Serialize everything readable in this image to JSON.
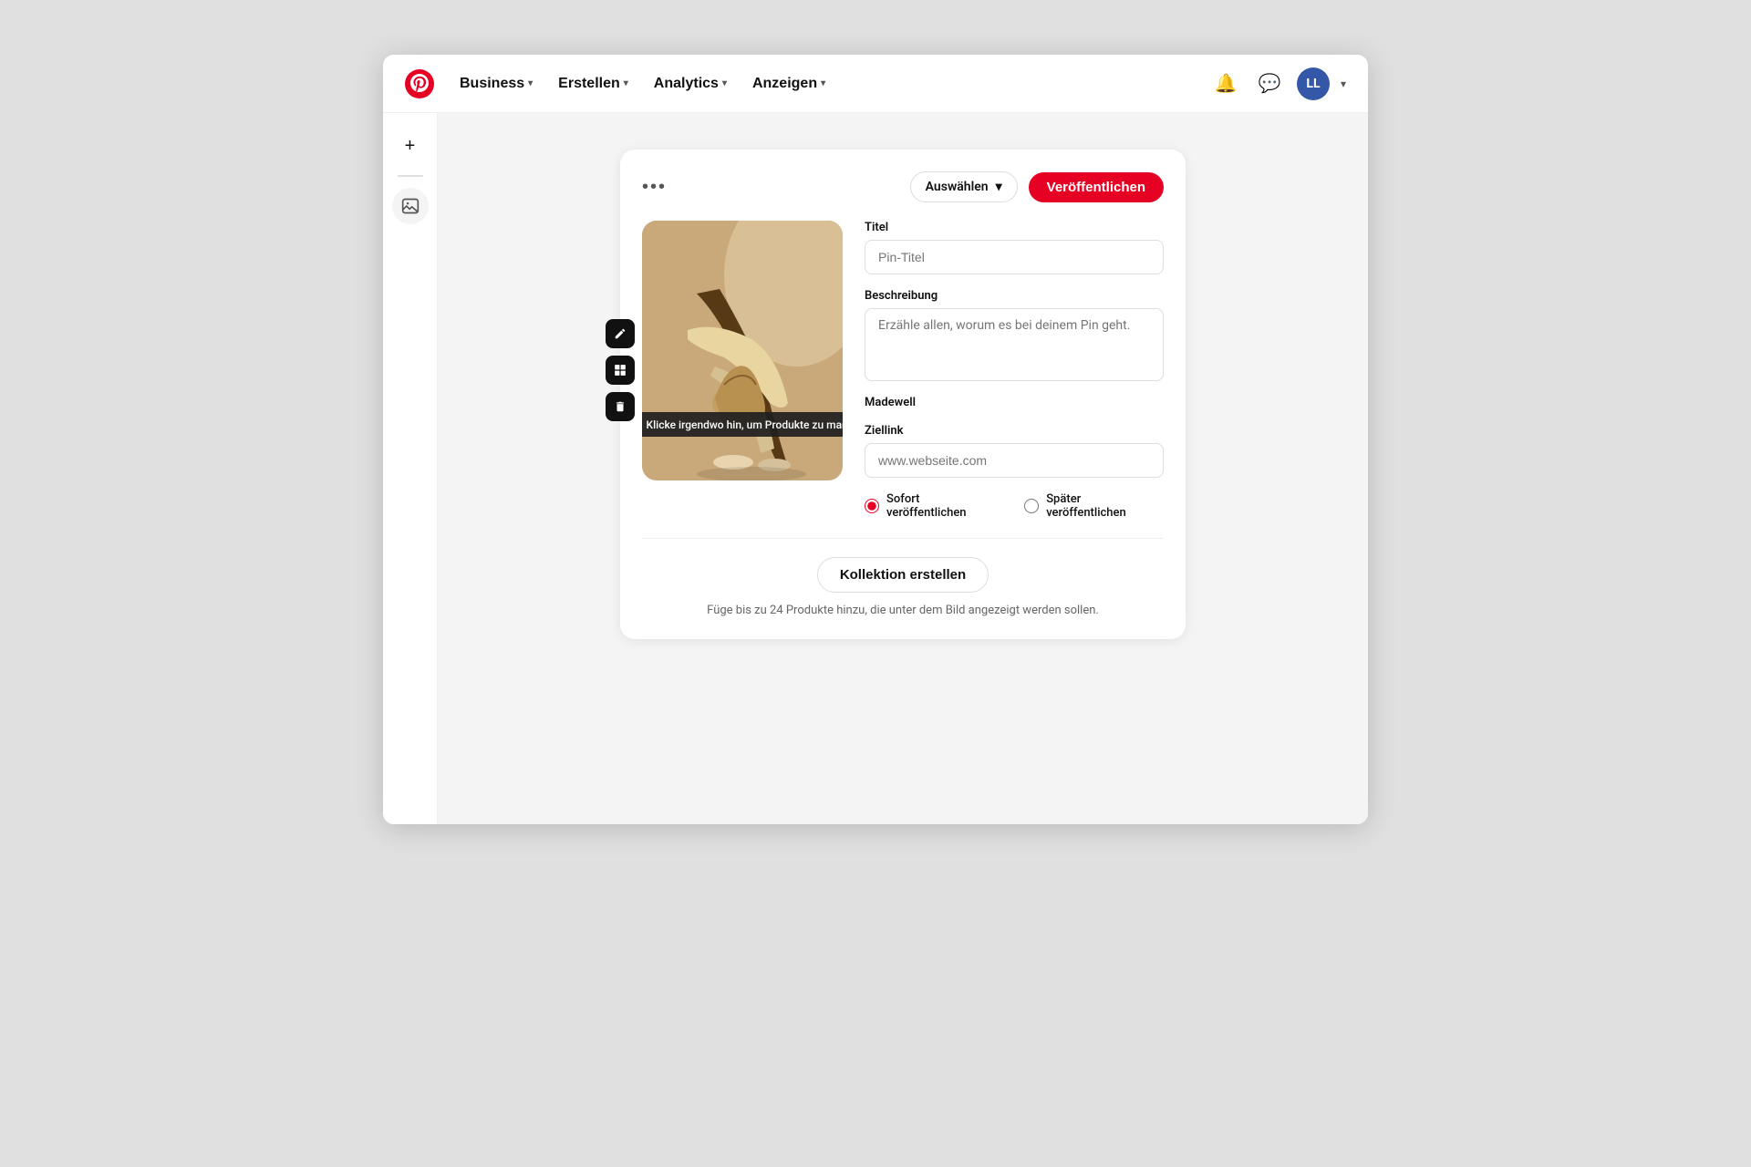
{
  "nav": {
    "business_label": "Business",
    "erstellen_label": "Erstellen",
    "analytics_label": "Analytics",
    "anzeigen_label": "Anzeigen",
    "user_initials": "LL"
  },
  "sidebar": {
    "add_label": "+",
    "image_label": "🖼"
  },
  "card": {
    "dots_label": "•••",
    "select_placeholder": "Auswählen",
    "publish_label": "Veröffentlichen",
    "title_label": "Titel",
    "title_placeholder": "Pin-Titel",
    "description_label": "Beschreibung",
    "description_placeholder": "Erzähle allen, worum es bei deinem Pin geht.",
    "brand_name": "Madewell",
    "link_label": "Ziellink",
    "link_placeholder": "www.webseite.com",
    "tag_tooltip": "Klicke irgendwo hin, um Produkte zu markieren",
    "publish_now_label": "Sofort veröffentlichen",
    "publish_later_label": "Später veröffentlichen",
    "collection_btn_label": "Kollektion erstellen",
    "collection_hint": "Füge bis zu 24 Produkte hinzu, die unter dem Bild angezeigt werden sollen."
  }
}
